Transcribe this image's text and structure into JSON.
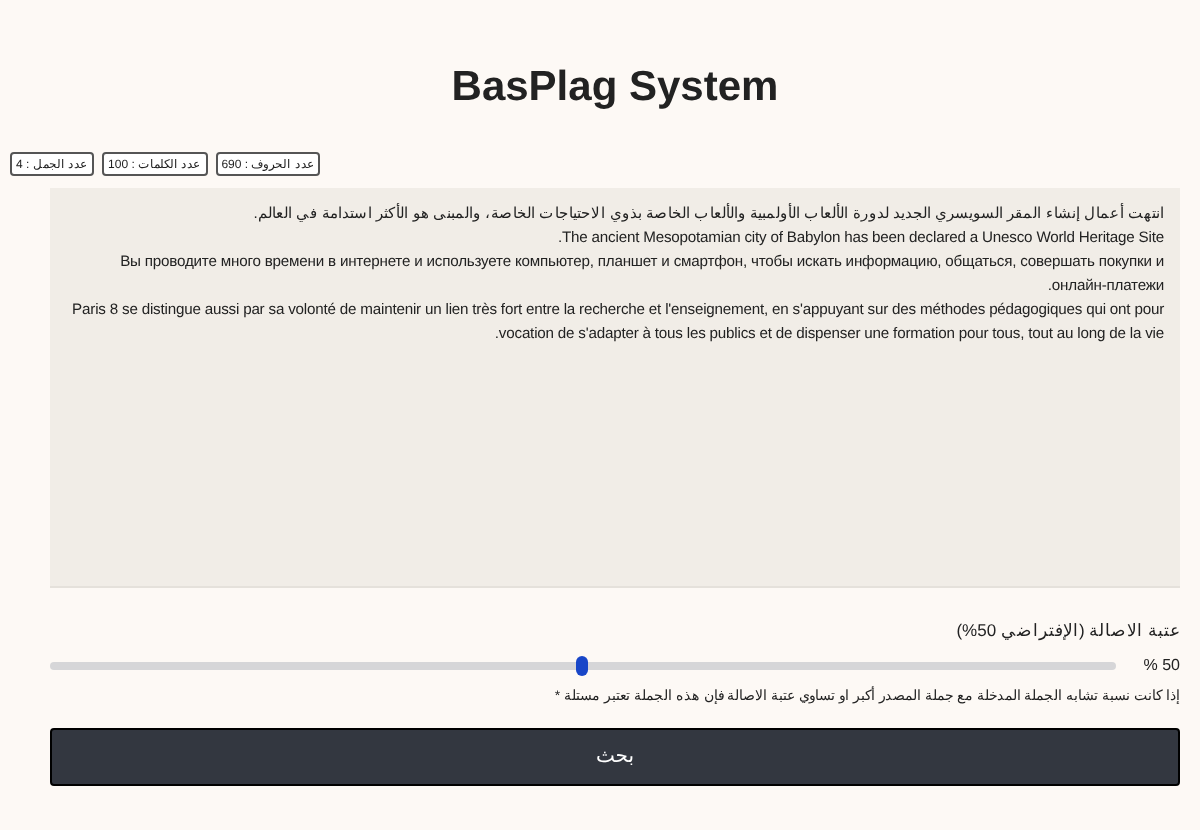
{
  "title": "BasPlag System",
  "counters": [
    {
      "label": "عدد الحروف : 690"
    },
    {
      "label": "عدد الكلمات : 100"
    },
    {
      "label": "عدد الجمل : 4"
    }
  ],
  "text_input": {
    "value": [
      "انتهت أعمال إنشاء المقر السويسري الجديد لدورة الألعاب الأولمبية والألعاب الخاصة بذوي الاحتياجات الخاصة، والمبنى هو الأكثر استدامة في العالم.",
      "The ancient Mesopotamian city of Babylon has been declared a Unesco World Heritage Site.",
      "Вы проводите много времени в интернете и используете компьютер, планшет и смартфон, чтобы искать информацию, общаться, совершать покупки и онлайн-платежи.",
      "Paris 8 se distingue aussi par sa volonté de maintenir un lien très fort entre la recherche et l'enseignement, en s'appuyant sur des méthodes pédagogiques qui ont pour vocation de s'adapter à tous les publics et de dispenser une formation pour tous, tout au long de la vie."
    ]
  },
  "threshold": {
    "label": "عتبة الاصالة (الإفتراضي 50%)",
    "reading": "50 %",
    "level": 0.5,
    "note": "إذا كانت نسبة تشابه الجملة المدخلة مع جملة المصدر أكبر او تساوي عتبة الاصالة فإن هذه الجملة تعتبر مستلة *"
  },
  "search_button": {
    "label": "بحث"
  }
}
